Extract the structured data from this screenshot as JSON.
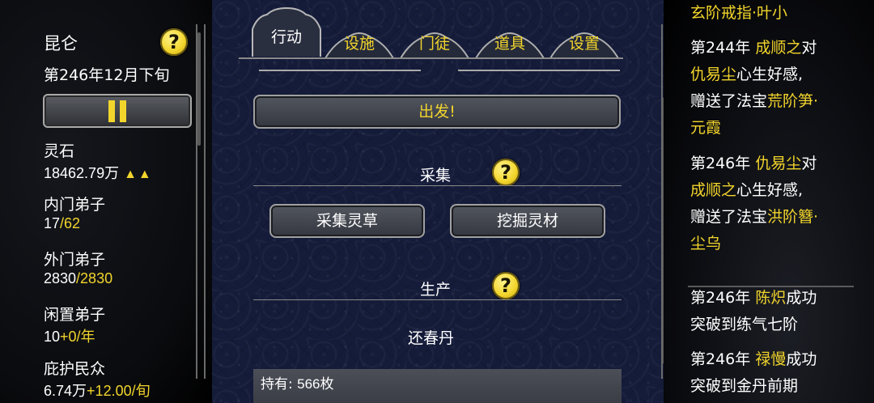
{
  "left": {
    "sect_name": "昆仑",
    "date": "第246年12月下旬",
    "help": "?",
    "stats": [
      {
        "label": "灵石",
        "value": "18462.79万",
        "extra": "▲▲"
      },
      {
        "label": "内门弟子",
        "value": "17",
        "extra": "/62"
      },
      {
        "label": "外门弟子",
        "value": "2830",
        "extra": "/2830"
      },
      {
        "label": "闲置弟子",
        "value": "10",
        "extra": "+0/年"
      },
      {
        "label": "庇护民众",
        "value": "6.74万",
        "extra": "+12.00/旬"
      }
    ]
  },
  "tabs": [
    {
      "label": "行动",
      "active": true
    },
    {
      "label": "设施",
      "active": false
    },
    {
      "label": "门徒",
      "active": false
    },
    {
      "label": "道具",
      "active": false
    },
    {
      "label": "设置",
      "active": false
    }
  ],
  "center": {
    "depart_label": "出发!",
    "gather_title": "采集",
    "gather_help": "?",
    "gather_buttons": [
      "采集灵草",
      "挖掘灵材"
    ],
    "produce_title": "生产",
    "produce_help": "?",
    "produce_item": "还春丹",
    "hold_label": "持有:",
    "hold_value": "566枚"
  },
  "log": {
    "top_partial": "玄阶戒指·叶小",
    "entries": [
      {
        "year": "第244年",
        "lines": [
          [
            {
              "t": "成顺之",
              "g": true
            },
            {
              "t": "对",
              "g": false
            }
          ],
          [
            {
              "t": "仇易尘",
              "g": true
            },
            {
              "t": "心生好感,",
              "g": false
            }
          ],
          [
            {
              "t": "赠送了法宝",
              "g": false
            },
            {
              "t": "荒阶笋·",
              "g": true
            }
          ],
          [
            {
              "t": "元霞",
              "g": true
            }
          ]
        ]
      },
      {
        "year": "第246年",
        "lines": [
          [
            {
              "t": "仇易尘",
              "g": true
            },
            {
              "t": "对",
              "g": false
            }
          ],
          [
            {
              "t": "成顺之",
              "g": true
            },
            {
              "t": "心生好感,",
              "g": false
            }
          ],
          [
            {
              "t": "赠送了法宝",
              "g": false
            },
            {
              "t": "洪阶簪·",
              "g": true
            }
          ],
          [
            {
              "t": "尘乌",
              "g": true
            }
          ]
        ]
      }
    ],
    "bottom_entries": [
      {
        "year": "第246年",
        "name": "陈炽",
        "rest1": "成功",
        "rest2": "突破到练气七阶"
      },
      {
        "year": "第246年",
        "name": "禄慢",
        "rest1": "成功",
        "rest2": "突破到金丹前期"
      }
    ]
  },
  "colors": {
    "gold": "#f2d52c",
    "panel_bg": "#151c3a",
    "button_bg": "#4a4d55"
  }
}
